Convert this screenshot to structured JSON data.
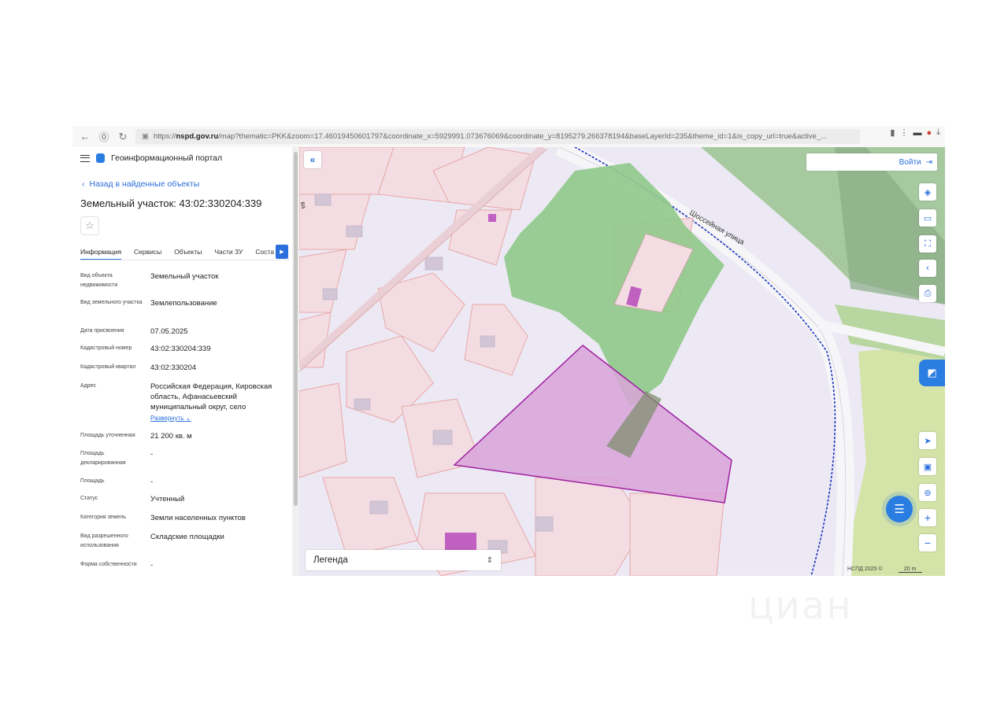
{
  "browser": {
    "url_prefix": "https://",
    "url_domain": "nspd.gov.ru",
    "url_rest": "/map?thematic=PKK&zoom=17.46019450601797&coordinate_x=5929991.073676069&coordinate_y=8195279.266378194&baseLayerId=235&theme_id=1&is_copy_url=true&active_..."
  },
  "sidebar": {
    "portal_title": "Геоинформационный портал",
    "back_link": "Назад в найденные объекты",
    "object_title": "Земельный участок: 43:02:330204:339",
    "tabs": [
      {
        "label": "Информация",
        "active": true
      },
      {
        "label": "Сервисы",
        "active": false
      },
      {
        "label": "Объекты",
        "active": false
      },
      {
        "label": "Части ЗУ",
        "active": false
      },
      {
        "label": "Соста",
        "active": false
      }
    ],
    "fields": [
      {
        "key": "Вид объекта недвижимости",
        "value": "Земельный участок"
      },
      {
        "key": "Вид земельного участка",
        "value": "Землепользование"
      },
      {
        "key": "Дата присвоения",
        "value": "07.05.2025"
      },
      {
        "key": "Кадастровый номер",
        "value": "43:02:330204:339"
      },
      {
        "key": "Кадастровый квартал",
        "value": "43:02:330204"
      },
      {
        "key": "Адрес",
        "value": "Российская Федерация, Кировская область, Афанасьевский муниципальный округ, село"
      },
      {
        "key": "Площадь уточненная",
        "value": "21 200 кв. м"
      },
      {
        "key": "Площадь декларированная",
        "value": "-"
      },
      {
        "key": "Площадь",
        "value": "-"
      },
      {
        "key": "Статус",
        "value": "Учтенный"
      },
      {
        "key": "Категория земель",
        "value": "Земли населенных пунктов"
      },
      {
        "key": "Вид разрешенного использования",
        "value": "Складские площадки"
      },
      {
        "key": "Форма собственности",
        "value": "-"
      }
    ],
    "expand_label": "Развернуть"
  },
  "map": {
    "login_label": "Войти",
    "legend_label": "Легенда",
    "street_label": "Шоссейная улица",
    "street_label_partial": "ва",
    "attribution": "НСПД 2025 ©",
    "scale": "20 m",
    "colors": {
      "parcel_fill": "#f3dde3",
      "parcel_stroke": "#e8a7a7",
      "selected_fill": "#d9a3d9",
      "selected_stroke": "#a020a0",
      "green_zone": "#8fc98a",
      "road": "#f6f6f8",
      "building": "#d2c6d6",
      "accent": "#2a7de1"
    }
  },
  "watermark": "циан"
}
